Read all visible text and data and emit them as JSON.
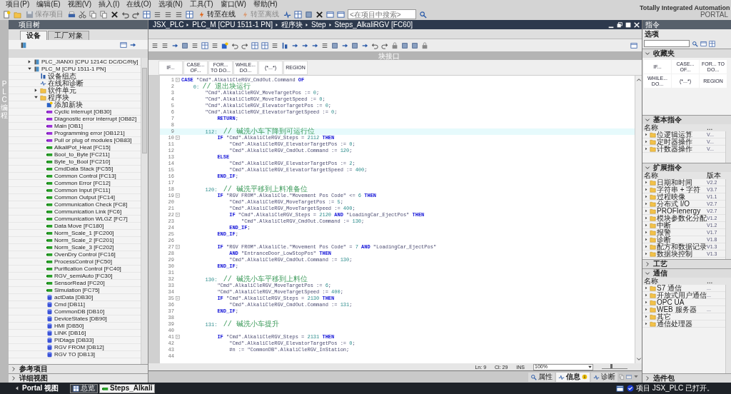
{
  "menu": [
    "项目(P)",
    "编辑(E)",
    "视图(V)",
    "插入(I)",
    "在线(O)",
    "选项(N)",
    "工具(T)",
    "窗口(W)",
    "帮助(H)"
  ],
  "toolbar": {
    "buttons": [
      {
        "label": "保存项目",
        "disabled": true
      },
      {
        "label": "转至在线",
        "disabled": false
      },
      {
        "label": "转至离线",
        "disabled": true
      }
    ],
    "search_placeholder": "<在项目中搜索>"
  },
  "brand": {
    "line1": "Totally Integrated Automation",
    "line2": "PORTAL"
  },
  "side_strip": "PLC 编程",
  "project_tree": {
    "title": "项目树",
    "tabs": [
      {
        "label": "设备",
        "selected": true
      },
      {
        "label": "工厂对象",
        "selected": false
      }
    ],
    "items": [
      {
        "label": "PLC_JIANXI [CPU 1214C DC/DC/Rly]",
        "kind": "plc",
        "expanded": false
      },
      {
        "label": "PLC_M [CPU 1511-1 PN]",
        "kind": "plc",
        "expanded": true,
        "children": [
          {
            "label": "设备组态",
            "kind": "config"
          },
          {
            "label": "在线和诊断",
            "kind": "online"
          },
          {
            "label": "软件单元",
            "kind": "folder",
            "expanded": false
          },
          {
            "label": "程序块",
            "kind": "folder",
            "expanded": true,
            "children": [
              {
                "label": "添加新块",
                "kind": "add"
              },
              {
                "label": "Cyclic interrupt [OB30]",
                "kind": "ob"
              },
              {
                "label": "Diagnostic error interrupt [OB82]",
                "kind": "ob"
              },
              {
                "label": "Main [OB1]",
                "kind": "ob"
              },
              {
                "label": "Programming error [OB121]",
                "kind": "ob"
              },
              {
                "label": "Pull or plug of modules [OB83]",
                "kind": "ob"
              },
              {
                "label": "AlkaliPot_Heat [FC15]",
                "kind": "fc"
              },
              {
                "label": "Bool_to_Byte [FC211]",
                "kind": "fc"
              },
              {
                "label": "Byte_to_Bool [FC210]",
                "kind": "fc"
              },
              {
                "label": "CmdData Stack [FC55]",
                "kind": "fc"
              },
              {
                "label": "Common Control [FC13]",
                "kind": "fc"
              },
              {
                "label": "Common Error [FC12]",
                "kind": "fc"
              },
              {
                "label": "Common Input [FC11]",
                "kind": "fc"
              },
              {
                "label": "Common Output [FC14]",
                "kind": "fc"
              },
              {
                "label": "Communication Check [FC8]",
                "kind": "fc"
              },
              {
                "label": "Communication Link [FC6]",
                "kind": "fc"
              },
              {
                "label": "Communication WLGZ [FC7]",
                "kind": "fc"
              },
              {
                "label": "Data Move [FC180]",
                "kind": "fc"
              },
              {
                "label": "Norm_Scale_1 [FC200]",
                "kind": "fc"
              },
              {
                "label": "Norm_Scale_2 [FC201]",
                "kind": "fc"
              },
              {
                "label": "Norm_Scale_3 [FC202]",
                "kind": "fc"
              },
              {
                "label": "OvenDry Control [FC16]",
                "kind": "fc"
              },
              {
                "label": "ProcessControl [FC50]",
                "kind": "fc"
              },
              {
                "label": "Purification Control [FC40]",
                "kind": "fc"
              },
              {
                "label": "RGV_semiAuto [FC30]",
                "kind": "fc"
              },
              {
                "label": "SensorRead [FC20]",
                "kind": "fc"
              },
              {
                "label": "Simulation [FC75]",
                "kind": "fc"
              },
              {
                "label": "actData [DB30]",
                "kind": "db"
              },
              {
                "label": "Cmd [DB11]",
                "kind": "db"
              },
              {
                "label": "CommonDB [DB10]",
                "kind": "db"
              },
              {
                "label": "DeviceStates [DB90]",
                "kind": "db"
              },
              {
                "label": "HMI [DB50]",
                "kind": "db"
              },
              {
                "label": "LINK [DB16]",
                "kind": "db"
              },
              {
                "label": "PIDtags [DB33]",
                "kind": "db"
              },
              {
                "label": "RGV FROM [DB12]",
                "kind": "db"
              },
              {
                "label": "RGV TO [DB13]",
                "kind": "db"
              }
            ]
          }
        ]
      }
    ],
    "sections": [
      {
        "label": "参考项目",
        "expanded": false
      },
      {
        "label": "详细视图",
        "expanded": false
      }
    ]
  },
  "editor": {
    "breadcrumb": [
      "JSX_PLC",
      "PLC_M [CPU 1511-1 PN]",
      "程序块",
      "Step",
      "Steps_AlkaliRGV [FC60]"
    ],
    "interface_label": "块接口",
    "palette": [
      "IF...",
      "CASE... OF...",
      "FOR... TO DO...",
      "WHILE... DO...",
      "(*...*)",
      "REGION"
    ],
    "lines": [
      {
        "n": "1",
        "fold": true,
        "current": false,
        "parts": [
          {
            "kind": "kw",
            "text": "CASE"
          },
          {
            "kind": "code",
            "text": " \"Cmd\".AlkaliCleRGV_CmdOut.Command "
          },
          {
            "kind": "kw",
            "text": "OF"
          }
        ]
      },
      {
        "n": "2",
        "fold": false,
        "current": false,
        "parts": [
          {
            "kind": "num",
            "text": "    0: "
          },
          {
            "kind": "cmt",
            "text": "// 退出块运行"
          }
        ]
      },
      {
        "n": "3",
        "fold": false,
        "current": false,
        "parts": [
          {
            "kind": "code",
            "text": "        \"Cmd\".AlkaliCleRGV_MoveTargetPos := "
          },
          {
            "kind": "num",
            "text": "0"
          },
          {
            "kind": "code",
            "text": ";"
          }
        ]
      },
      {
        "n": "4",
        "fold": false,
        "current": false,
        "parts": [
          {
            "kind": "code",
            "text": "        \"Cmd\".AlkaliCleRGV_MoveTargetSpeed := "
          },
          {
            "kind": "num",
            "text": "0"
          },
          {
            "kind": "code",
            "text": ";"
          }
        ]
      },
      {
        "n": "5",
        "fold": false,
        "current": false,
        "parts": [
          {
            "kind": "code",
            "text": "        \"Cmd\".AlkaliCleRGV_ElevatorTargetPos := "
          },
          {
            "kind": "num",
            "text": "0"
          },
          {
            "kind": "code",
            "text": ";"
          }
        ]
      },
      {
        "n": "6",
        "fold": false,
        "current": false,
        "parts": [
          {
            "kind": "code",
            "text": "        \"Cmd\".AlkaliCleRGV_ElevatorTargetSpeed := "
          },
          {
            "kind": "num",
            "text": "0"
          },
          {
            "kind": "code",
            "text": ";"
          }
        ]
      },
      {
        "n": "7",
        "fold": false,
        "current": false,
        "parts": [
          {
            "kind": "kw",
            "text": "            RETURN"
          },
          {
            "kind": "code",
            "text": ";"
          }
        ]
      },
      {
        "n": "8",
        "fold": false,
        "current": false
      },
      {
        "n": "9",
        "fold": false,
        "current": true,
        "parts": [
          {
            "kind": "num",
            "text": "        112:  "
          },
          {
            "kind": "cmt",
            "text": "// 碱洗小车下降到可运行位"
          }
        ]
      },
      {
        "n": "10",
        "fold": true,
        "current": false,
        "parts": [
          {
            "kind": "kw",
            "text": "            IF"
          },
          {
            "kind": "code",
            "text": " \"Cmd\".AlkaliCleRGV_Steps = "
          },
          {
            "kind": "num",
            "text": "2112"
          },
          {
            "kind": "kw",
            "text": " THEN"
          }
        ]
      },
      {
        "n": "11",
        "fold": false,
        "current": false,
        "parts": [
          {
            "kind": "code",
            "text": "                \"Cmd\".AlkaliCleRGV_ElevatorTargetPos := "
          },
          {
            "kind": "num",
            "text": "0"
          },
          {
            "kind": "code",
            "text": ";"
          }
        ]
      },
      {
        "n": "12",
        "fold": false,
        "current": false,
        "parts": [
          {
            "kind": "code",
            "text": "                \"Cmd\".AlkaliCleRGV_CmdOut.Command := "
          },
          {
            "kind": "num",
            "text": "120"
          },
          {
            "kind": "code",
            "text": ";"
          }
        ]
      },
      {
        "n": "13",
        "fold": false,
        "current": false,
        "parts": [
          {
            "kind": "kw",
            "text": "            ELSE"
          }
        ]
      },
      {
        "n": "14",
        "fold": false,
        "current": false,
        "parts": [
          {
            "kind": "code",
            "text": "                \"Cmd\".AlkaliCleRGV_ElevatorTargetPos := "
          },
          {
            "kind": "num",
            "text": "2"
          },
          {
            "kind": "code",
            "text": ";"
          }
        ]
      },
      {
        "n": "15",
        "fold": false,
        "current": false,
        "parts": [
          {
            "kind": "code",
            "text": "                \"Cmd\".AlkaliCleRGV_ElevatorTargetSpeed := "
          },
          {
            "kind": "num",
            "text": "400"
          },
          {
            "kind": "code",
            "text": ";"
          }
        ]
      },
      {
        "n": "16",
        "fold": false,
        "current": false,
        "parts": [
          {
            "kind": "kw",
            "text": "            END_IF"
          },
          {
            "kind": "code",
            "text": ";"
          }
        ]
      },
      {
        "n": "17",
        "fold": false,
        "current": false
      },
      {
        "n": "18",
        "fold": false,
        "current": false,
        "parts": [
          {
            "kind": "num",
            "text": "        120:  "
          },
          {
            "kind": "cmt",
            "text": "// 碱洗平移到上料准备位"
          }
        ]
      },
      {
        "n": "19",
        "fold": true,
        "current": false,
        "parts": [
          {
            "kind": "kw",
            "text": "            IF"
          },
          {
            "kind": "code",
            "text": " \"RGV FROM\".AlkaliCle.\"Movement Pos Code\" <= "
          },
          {
            "kind": "num",
            "text": "6"
          },
          {
            "kind": "kw",
            "text": " THEN"
          }
        ]
      },
      {
        "n": "20",
        "fold": false,
        "current": false,
        "parts": [
          {
            "kind": "code",
            "text": "                \"Cmd\".AlkaliCleRGV_MoveTargetPos := "
          },
          {
            "kind": "num",
            "text": "5"
          },
          {
            "kind": "code",
            "text": ";"
          }
        ]
      },
      {
        "n": "21",
        "fold": false,
        "current": false,
        "parts": [
          {
            "kind": "code",
            "text": "                \"Cmd\".AlkaliCleRGV_MoveTargetSpeed := "
          },
          {
            "kind": "num",
            "text": "400"
          },
          {
            "kind": "code",
            "text": ";"
          }
        ]
      },
      {
        "n": "22",
        "fold": true,
        "current": false,
        "parts": [
          {
            "kind": "kw",
            "text": "                IF"
          },
          {
            "kind": "code",
            "text": " \"Cmd\".AlkaliCleRGV_Steps = "
          },
          {
            "kind": "num",
            "text": "2120"
          },
          {
            "kind": "kw",
            "text": " AND"
          },
          {
            "kind": "code",
            "text": " \"LoadingCar_EjectPos\" "
          },
          {
            "kind": "kw",
            "text": "THEN"
          }
        ]
      },
      {
        "n": "23",
        "fold": false,
        "current": false,
        "parts": [
          {
            "kind": "code",
            "text": "                    \"Cmd\".AlkaliCleRGV_CmdOut.Command := "
          },
          {
            "kind": "num",
            "text": "130"
          },
          {
            "kind": "code",
            "text": ";"
          }
        ]
      },
      {
        "n": "24",
        "fold": false,
        "current": false,
        "parts": [
          {
            "kind": "kw",
            "text": "                END_IF"
          },
          {
            "kind": "code",
            "text": ";"
          }
        ]
      },
      {
        "n": "25",
        "fold": false,
        "current": false,
        "parts": [
          {
            "kind": "kw",
            "text": "            END_IF"
          },
          {
            "kind": "code",
            "text": ";"
          }
        ]
      },
      {
        "n": "26",
        "fold": false,
        "current": false
      },
      {
        "n": "27",
        "fold": true,
        "current": false,
        "parts": [
          {
            "kind": "kw",
            "text": "            IF"
          },
          {
            "kind": "code",
            "text": " \"RGV FROM\".AlkaliCle.\"Movement Pos Code\" = "
          },
          {
            "kind": "num",
            "text": "7"
          },
          {
            "kind": "kw",
            "text": " AND"
          },
          {
            "kind": "code",
            "text": " \"LoadingCar_EjectPos\""
          }
        ]
      },
      {
        "n": "28",
        "fold": false,
        "current": false,
        "parts": [
          {
            "kind": "kw",
            "text": "                AND"
          },
          {
            "kind": "code",
            "text": " \"EntranceDoor_LowStopPos\" "
          },
          {
            "kind": "kw",
            "text": "THEN"
          }
        ]
      },
      {
        "n": "29",
        "fold": false,
        "current": false,
        "parts": [
          {
            "kind": "code",
            "text": "                \"Cmd\".AlkaliCleRGV_CmdOut.Command := "
          },
          {
            "kind": "num",
            "text": "130"
          },
          {
            "kind": "code",
            "text": ";"
          }
        ]
      },
      {
        "n": "30",
        "fold": false,
        "current": false,
        "parts": [
          {
            "kind": "kw",
            "text": "            END_IF"
          },
          {
            "kind": "code",
            "text": ";"
          }
        ]
      },
      {
        "n": "31",
        "fold": false,
        "current": false
      },
      {
        "n": "32",
        "fold": false,
        "current": false,
        "parts": [
          {
            "kind": "num",
            "text": "        130:  "
          },
          {
            "kind": "cmt",
            "text": "// 碱洗小车平移到上料位"
          }
        ]
      },
      {
        "n": "33",
        "fold": false,
        "current": false,
        "parts": [
          {
            "kind": "code",
            "text": "            \"Cmd\".AlkaliCleRGV_MoveTargetPos := "
          },
          {
            "kind": "num",
            "text": "6"
          },
          {
            "kind": "code",
            "text": ";"
          }
        ]
      },
      {
        "n": "34",
        "fold": false,
        "current": false,
        "parts": [
          {
            "kind": "code",
            "text": "            \"Cmd\".AlkaliCleRGV_MoveTargetSpeed := "
          },
          {
            "kind": "num",
            "text": "400"
          },
          {
            "kind": "code",
            "text": ";"
          }
        ]
      },
      {
        "n": "35",
        "fold": true,
        "current": false,
        "parts": [
          {
            "kind": "kw",
            "text": "            IF"
          },
          {
            "kind": "code",
            "text": " \"Cmd\".AlkaliCleRGV_Steps = "
          },
          {
            "kind": "num",
            "text": "2130"
          },
          {
            "kind": "kw",
            "text": " THEN"
          }
        ]
      },
      {
        "n": "36",
        "fold": false,
        "current": false,
        "parts": [
          {
            "kind": "code",
            "text": "                \"Cmd\".AlkaliCleRGV_CmdOut.Command := "
          },
          {
            "kind": "num",
            "text": "131"
          },
          {
            "kind": "code",
            "text": ";"
          }
        ]
      },
      {
        "n": "37",
        "fold": false,
        "current": false,
        "parts": [
          {
            "kind": "kw",
            "text": "            END_IF"
          },
          {
            "kind": "code",
            "text": ";"
          }
        ]
      },
      {
        "n": "38",
        "fold": false,
        "current": false
      },
      {
        "n": "39",
        "fold": false,
        "current": false,
        "parts": [
          {
            "kind": "num",
            "text": "        131:  "
          },
          {
            "kind": "cmt",
            "text": "// 碱洗小车提升"
          }
        ]
      },
      {
        "n": "40",
        "fold": false,
        "current": false
      },
      {
        "n": "41",
        "fold": true,
        "current": false,
        "parts": [
          {
            "kind": "kw",
            "text": "            IF"
          },
          {
            "kind": "code",
            "text": " \"Cmd\".AlkaliCleRGV_Steps = "
          },
          {
            "kind": "num",
            "text": "2131"
          },
          {
            "kind": "kw",
            "text": " THEN"
          }
        ]
      },
      {
        "n": "42",
        "fold": false,
        "current": false,
        "parts": [
          {
            "kind": "code",
            "text": "                \"Cmd\".AlkaliCleRGV_ElevatorTargetPos := "
          },
          {
            "kind": "num",
            "text": "0"
          },
          {
            "kind": "code",
            "text": ";"
          }
        ]
      },
      {
        "n": "43",
        "fold": false,
        "current": false,
        "parts": [
          {
            "kind": "code",
            "text": "                #n := \"CommonDB\".AlkaliCleRGV_InStation;"
          }
        ]
      },
      {
        "n": "44",
        "fold": false,
        "current": false
      }
    ],
    "status": {
      "line": "Ln: 9",
      "column": "Cl: 29",
      "mode": "INS",
      "zoom": "100%",
      "zoom_slider": {
        "level": 0.35
      }
    },
    "bottom_tabs": [
      {
        "label": "属性",
        "selected": false
      },
      {
        "label": "信息",
        "selected": true
      },
      {
        "label": "诊断",
        "selected": false
      }
    ]
  },
  "instructions": {
    "title": "指令",
    "options_label": "选项",
    "sections": [
      {
        "title": "收藏夹",
        "expanded": true,
        "kind": "palette",
        "palette": [
          "IF...",
          "CASE... OF...",
          "FOR... TO DO...",
          "WHILE... DO...",
          "(*...*)",
          "REGION"
        ]
      },
      {
        "title": "基本指令",
        "expanded": true,
        "kind": "table",
        "columns": [
          "名称",
          "..."
        ],
        "rows": [
          {
            "name": "位逻辑运算",
            "version": "V..."
          },
          {
            "name": "定时器操作",
            "version": "V..."
          },
          {
            "name": "计数器操作",
            "version": "V..."
          }
        ]
      },
      {
        "title": "扩展指令",
        "expanded": true,
        "kind": "table",
        "columns": [
          "名称",
          "版本"
        ],
        "rows": [
          {
            "name": "日期和时间",
            "version": "V2.2"
          },
          {
            "name": "字符串 + 字符",
            "version": "V3.7"
          },
          {
            "name": "过程映像",
            "version": "V1.1"
          },
          {
            "name": "分布式 I/O",
            "version": "V2.7"
          },
          {
            "name": "PROFIenergy",
            "version": "V2.7"
          },
          {
            "name": "模块参数化分配",
            "version": "V1.2"
          },
          {
            "name": "中断",
            "version": "V1.2"
          },
          {
            "name": "报警",
            "version": "V1.7"
          },
          {
            "name": "诊断",
            "version": "V1.8"
          },
          {
            "name": "配方和数据记录",
            "version": "V1.3"
          },
          {
            "name": "数据块控制",
            "version": "V1.3"
          }
        ]
      },
      {
        "title": "工艺",
        "expanded": false
      },
      {
        "title": "通信",
        "expanded": true,
        "kind": "table",
        "columns": [
          "名称",
          "..."
        ],
        "rows": [
          {
            "name": "S7 通信",
            "version": "..."
          },
          {
            "name": "开放式用户通信",
            "version": "..."
          },
          {
            "name": "OPC UA"
          },
          {
            "name": "WEB 服务器",
            "version": "..."
          },
          {
            "name": "其它"
          },
          {
            "name": "通信处理器"
          }
        ]
      },
      {
        "title": "选件包",
        "expanded": false
      }
    ]
  },
  "taskbar": {
    "portal": "Portal 视图",
    "windows": [
      {
        "label": "总览",
        "selected": false
      },
      {
        "label": "Steps_Alkali",
        "selected": true
      }
    ],
    "status": "项目 JSX_PLC 已打开。"
  }
}
